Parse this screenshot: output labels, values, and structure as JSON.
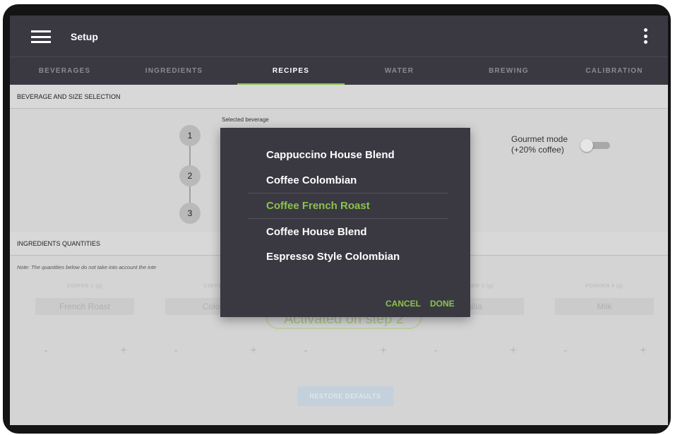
{
  "app": {
    "title": "Setup"
  },
  "tabs": [
    {
      "label": "BEVERAGES",
      "active": false
    },
    {
      "label": "INGREDIENTS",
      "active": false
    },
    {
      "label": "RECIPES",
      "active": true
    },
    {
      "label": "WATER",
      "active": false
    },
    {
      "label": "BREWING",
      "active": false
    },
    {
      "label": "CALIBRATION",
      "active": false
    }
  ],
  "sections": {
    "beverage_selection": "BEVERAGE AND SIZE SELECTION",
    "ingredients_quantities": "INGREDIENTS QUANTITIES"
  },
  "stepper": {
    "steps": [
      "1",
      "2",
      "3"
    ]
  },
  "selected_beverage_label": "Selected beverage",
  "gourmet": {
    "line1": "Gourmet mode",
    "line2": "(+20% coffee)",
    "enabled": false
  },
  "note": "Note: The quantities below do not take into account the inte",
  "ingredients": [
    {
      "label": "COFFEE 1 (g)",
      "value": "French Roast",
      "minus": "-",
      "plus": "+"
    },
    {
      "label": "COFFEE",
      "value": "Colom",
      "minus": "-",
      "plus": "+"
    },
    {
      "label": "",
      "value": "",
      "minus": "-",
      "plus": "+"
    },
    {
      "label": "POWDER 3 (g)",
      "value": "nilla",
      "minus": "-",
      "plus": "+"
    },
    {
      "label": "POWDER 4 (g)",
      "value": "Milk",
      "minus": "-",
      "plus": "+"
    }
  ],
  "activated_badge": "Activated on step 2",
  "restore_button": "RESTORE DEFAULTS",
  "dialog": {
    "options": [
      "Cappuccino House Blend",
      "Coffee Colombian",
      "Coffee French Roast",
      "Coffee House Blend",
      "Espresso Style Colombian"
    ],
    "selected_option": "Coffee French Roast",
    "cancel": "CANCEL",
    "done": "DONE"
  },
  "colors": {
    "accent": "#8bc34a",
    "appbar": "#3a3942",
    "dialog": "#3a3942"
  }
}
